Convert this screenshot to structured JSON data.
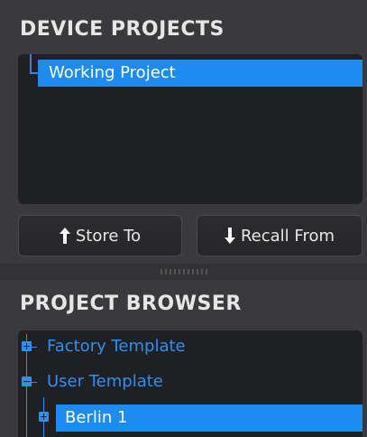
{
  "device_projects": {
    "title": "DEVICE PROJECTS",
    "items": [
      {
        "label": "Working Project",
        "selected": true
      }
    ]
  },
  "buttons": {
    "store_label": "Store To",
    "recall_label": "Recall From"
  },
  "project_browser": {
    "title": "PROJECT BROWSER",
    "items": [
      {
        "label": "Factory Template",
        "expanded": false
      },
      {
        "label": "User Template",
        "expanded": true
      },
      {
        "label": "Berlin 1",
        "expanded": false,
        "selected": true
      }
    ]
  },
  "colors": {
    "accent": "#1c8cf2",
    "tree_text": "#2f8ff5",
    "panel_bg": "#1f2022",
    "window_bg": "#3a3a3c"
  },
  "icons": {
    "store": "arrow-up-icon",
    "recall": "arrow-down-icon",
    "expand": "plus-box-icon",
    "collapse": "minus-box-icon"
  }
}
